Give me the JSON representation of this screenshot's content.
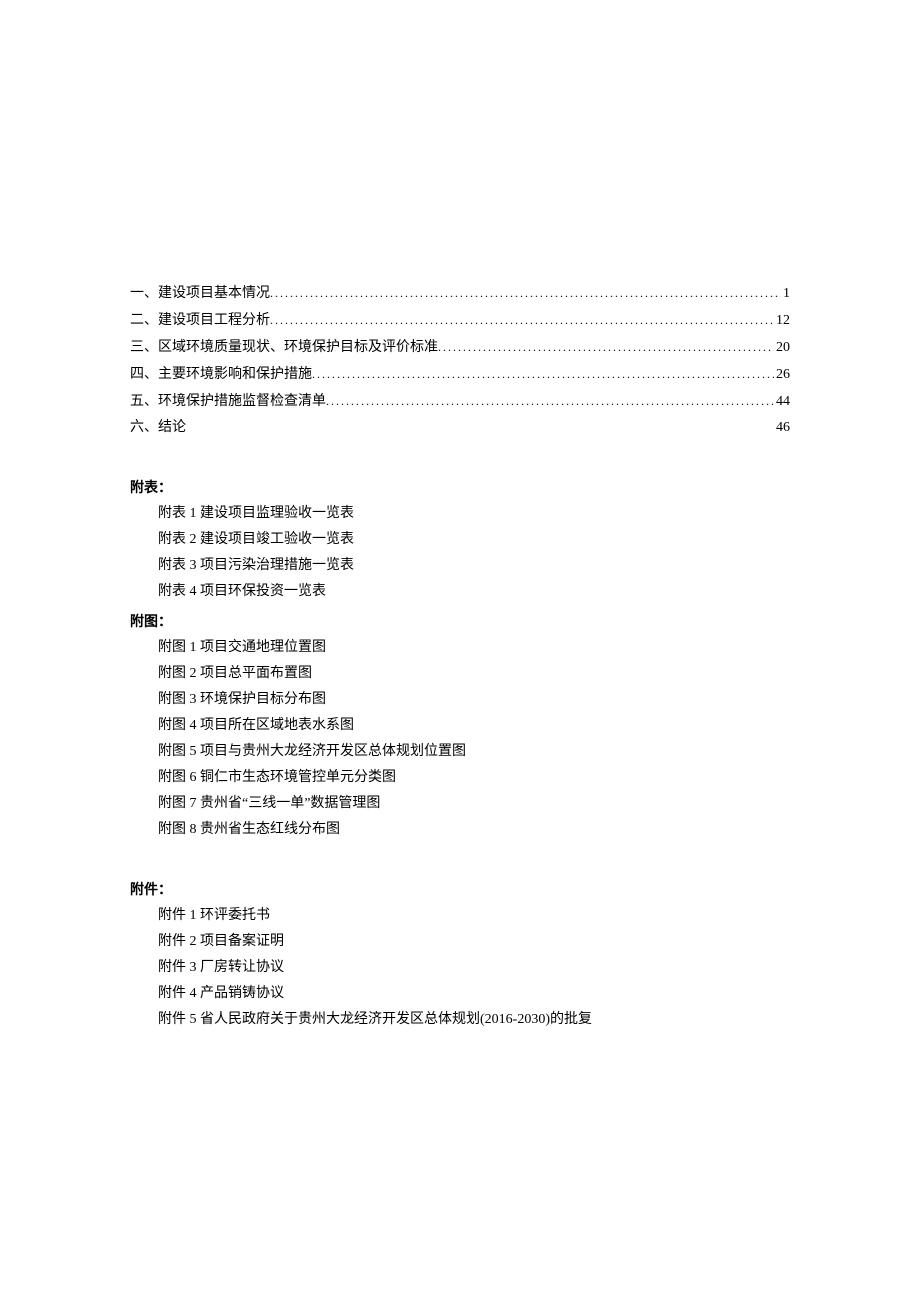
{
  "toc": [
    {
      "title": "一、建设项目基本情况",
      "page": "1",
      "dots": true
    },
    {
      "title": "二、建设项目工程分析",
      "page": "12",
      "dots": true
    },
    {
      "title": "三、区域环境质量现状、环境保护目标及评价标准",
      "page": "20",
      "dots": true
    },
    {
      "title": "四、主要环境影响和保护措施",
      "page": "26",
      "dots": true
    },
    {
      "title": "五、环境保护措施监督检查清单",
      "page": "44",
      "dots": true
    },
    {
      "title": "六、结论",
      "page": "46",
      "dots": false
    }
  ],
  "sections": {
    "tables_heading": "附表：",
    "tables": [
      "附表 1 建设项目监理验收一览表",
      "附表 2 建设项目竣工验收一览表",
      "附表 3 项目污染治理措施一览表",
      "附表 4 项目环保投资一览表"
    ],
    "figures_heading": "附图：",
    "figures": [
      "附图 1 项目交通地理位置图",
      "附图 2 项目总平面布置图",
      "附图 3 环境保护目标分布图",
      "附图 4 项目所在区域地表水系图",
      "附图 5 项目与贵州大龙经济开发区总体规划位置图",
      "附图 6 铜仁市生态环境管控单元分类图",
      "附图 7 贵州省“三线一单”数据管理图",
      "附图 8 贵州省生态红线分布图"
    ],
    "attachments_heading": "附件：",
    "attachments": [
      "附件 1 环评委托书",
      "附件 2 项目备案证明",
      "附件 3 厂房转让协议",
      "附件 4 产品销铸协议",
      "附件 5 省人民政府关于贵州大龙经济开发区总体规划(2016-2030)的批复"
    ]
  }
}
